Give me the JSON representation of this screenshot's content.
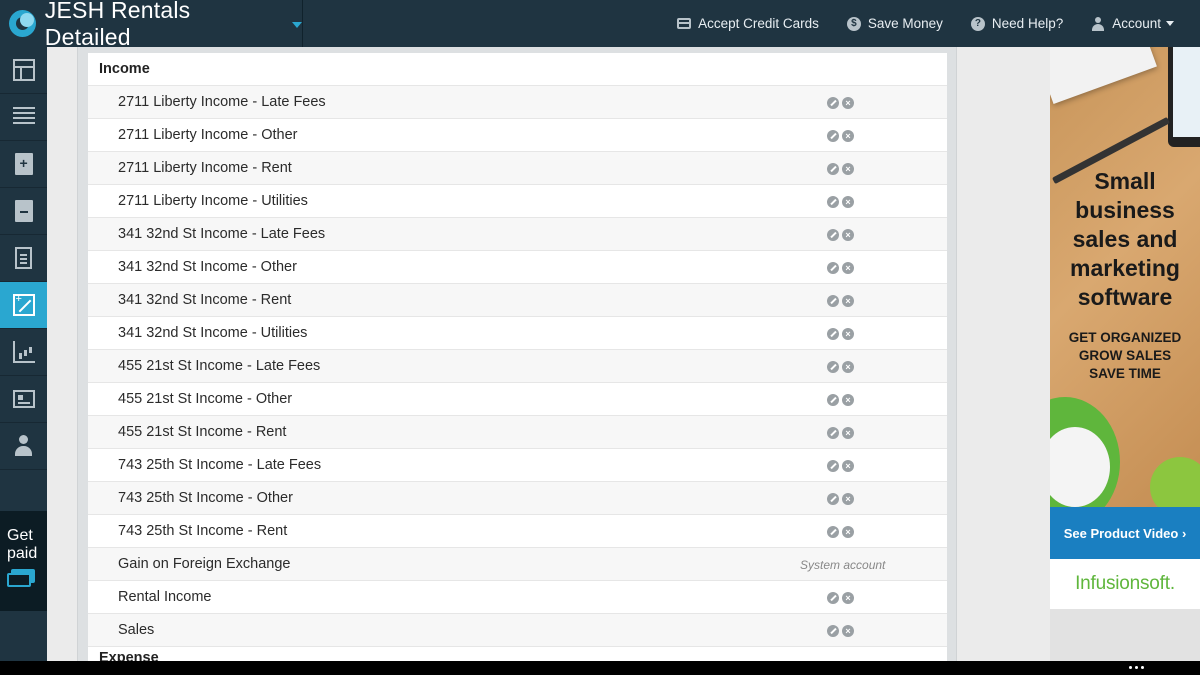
{
  "header": {
    "app_title": "JESH Rentals Detailed",
    "nav": [
      {
        "label": "Accept Credit Cards",
        "icon": "credit-card-icon"
      },
      {
        "label": "Save Money",
        "icon": "coin-icon"
      },
      {
        "label": "Need Help?",
        "icon": "help-icon"
      },
      {
        "label": "Account",
        "icon": "user-icon"
      }
    ]
  },
  "sidebar": {
    "items": [
      {
        "icon": "dashboard-icon"
      },
      {
        "icon": "list-icon"
      },
      {
        "icon": "add-document-icon"
      },
      {
        "icon": "document-icon"
      },
      {
        "icon": "receipt-icon"
      },
      {
        "icon": "plus-minus-icon",
        "active": true
      },
      {
        "icon": "chart-icon"
      },
      {
        "icon": "card-icon"
      },
      {
        "icon": "people-icon"
      }
    ],
    "get_paid": {
      "line1": "Get",
      "line2": "paid"
    }
  },
  "accounts": {
    "group_income": "Income",
    "rows": [
      {
        "name": "2711 Liberty Income - Late Fees"
      },
      {
        "name": "2711 Liberty Income - Other"
      },
      {
        "name": "2711 Liberty Income - Rent"
      },
      {
        "name": "2711 Liberty Income - Utilities"
      },
      {
        "name": "341 32nd St Income - Late Fees"
      },
      {
        "name": "341 32nd St Income - Other"
      },
      {
        "name": "341 32nd St Income - Rent"
      },
      {
        "name": "341 32nd St Income - Utilities"
      },
      {
        "name": "455 21st St Income - Late Fees"
      },
      {
        "name": "455 21st St Income - Other"
      },
      {
        "name": "455 21st St Income - Rent"
      },
      {
        "name": "743 25th St Income - Late Fees"
      },
      {
        "name": "743 25th St Income - Other"
      },
      {
        "name": "743 25th St Income - Rent"
      },
      {
        "name": "Gain on Foreign Exchange",
        "system": "System account"
      },
      {
        "name": "Rental Income"
      },
      {
        "name": "Sales"
      }
    ],
    "group_expense": "Expense"
  },
  "ad": {
    "headline": [
      "Small",
      "business",
      "sales and",
      "marketing",
      "software"
    ],
    "subline": [
      "GET ORGANIZED",
      "GROW SALES",
      "SAVE TIME"
    ],
    "video_button": "See Product Video ›",
    "brand": "Infusionsoft."
  },
  "colors": {
    "header_bg": "#1f3441",
    "accent": "#2aa7d0",
    "brand_green": "#5fb63c",
    "video_blue": "#1a7fc1"
  }
}
